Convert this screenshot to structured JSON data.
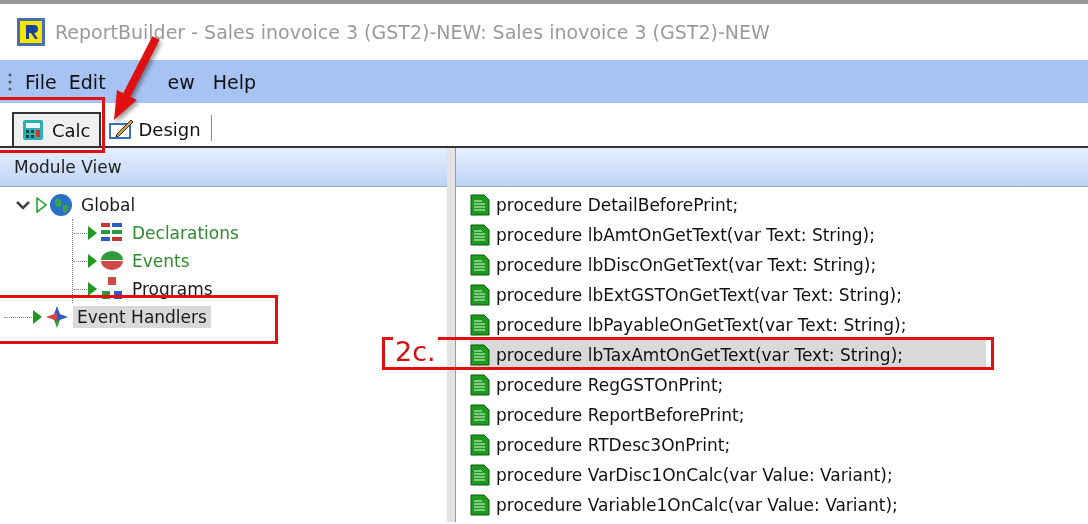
{
  "window": {
    "title": "ReportBuilder - Sales inovoice 3 (GST2)-NEW: Sales inovoice 3 (GST2)-NEW"
  },
  "menu": [
    {
      "label": "File"
    },
    {
      "label": "Edit"
    },
    {
      "label": "ew"
    },
    {
      "label": "Help"
    }
  ],
  "tabs": [
    {
      "label": "Calc",
      "kind": "calc",
      "selected": true
    },
    {
      "label": "Design",
      "kind": "design",
      "selected": false
    }
  ],
  "module_view": {
    "title": "Module View",
    "tree": [
      {
        "label": "Global",
        "kind": "globe",
        "expanded": true,
        "selected": false,
        "color": "#1a1a1a",
        "children": [
          {
            "label": "Declarations",
            "kind": "declarations",
            "selected": false,
            "color": "#2e8b2e"
          },
          {
            "label": "Events",
            "kind": "events",
            "selected": false,
            "color": "#2e8b2e"
          },
          {
            "label": "Programs",
            "kind": "programs",
            "selected": false,
            "color": "#1a1a1a"
          }
        ]
      },
      {
        "label": "Event Handlers",
        "kind": "handlers",
        "expanded": false,
        "selected": true,
        "color": "#1a1a1a"
      }
    ]
  },
  "procedures": [
    {
      "label": "procedure DetailBeforePrint;",
      "selected": false
    },
    {
      "label": "procedure lbAmtOnGetText(var Text: String);",
      "selected": false
    },
    {
      "label": "procedure lbDiscOnGetText(var Text: String);",
      "selected": false
    },
    {
      "label": "procedure lbExtGSTOnGetText(var Text: String);",
      "selected": false
    },
    {
      "label": "procedure lbPayableOnGetText(var Text: String);",
      "selected": false
    },
    {
      "label": "procedure lbTaxAmtOnGetText(var Text: String);",
      "selected": true
    },
    {
      "label": "procedure RegGSTOnPrint;",
      "selected": false
    },
    {
      "label": "procedure ReportBeforePrint;",
      "selected": false
    },
    {
      "label": "procedure RTDesc3OnPrint;",
      "selected": false
    },
    {
      "label": "procedure VarDisc1OnCalc(var Value: Variant);",
      "selected": false
    },
    {
      "label": "procedure Variable1OnCalc(var Value: Variant);",
      "selected": false
    }
  ],
  "annotation": {
    "callout": "2c."
  }
}
